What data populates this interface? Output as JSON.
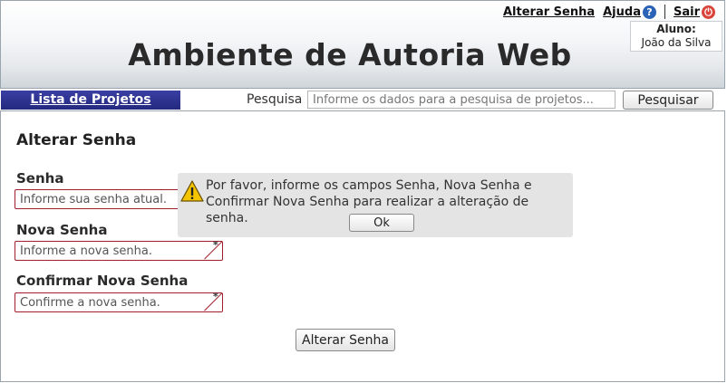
{
  "header": {
    "title": "Ambiente de Autoria Web",
    "links": {
      "change_password": "Alterar Senha",
      "help": "Ajuda",
      "logout": "Sair"
    },
    "user": {
      "label": "Aluno:",
      "name": "João da Silva"
    }
  },
  "toolbar": {
    "projects_tab": "Lista de Projetos",
    "search_label": "Pesquisa",
    "search_placeholder": "Informe os dados para a pesquisa de projetos...",
    "search_button": "Pesquisar"
  },
  "form": {
    "title": "Alterar Senha",
    "fields": [
      {
        "label": "Senha",
        "placeholder": "Informe sua senha atual."
      },
      {
        "label": "Nova Senha",
        "placeholder": "Informe a nova senha."
      },
      {
        "label": "Confirmar Nova Senha",
        "placeholder": "Confirme a nova senha."
      }
    ],
    "required_marker": "*",
    "submit": "Alterar Senha"
  },
  "alert": {
    "icon": "warning-icon",
    "message_line1": "Por favor, informe os campos Senha, Nova Senha e",
    "message_line2": "Confirmar Nova Senha para realizar a alteração de senha.",
    "ok": "Ok"
  },
  "colors": {
    "tab_bg": "#2b3090",
    "required_border": "#a11f2c",
    "alert_bg": "#e4e4e4",
    "help_icon": "#2a62b8",
    "logout_icon": "#d9453a"
  }
}
